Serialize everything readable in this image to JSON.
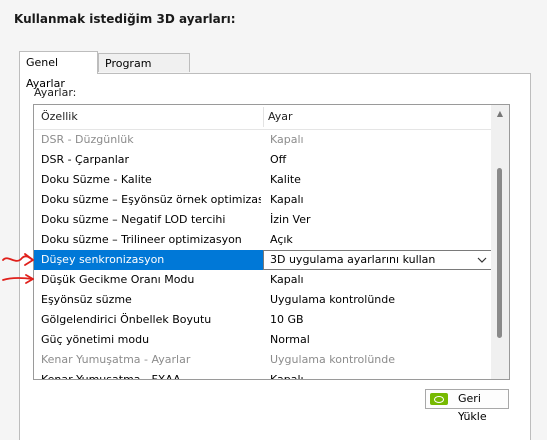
{
  "header": {
    "title": "Kullanmak istediğim 3D ayarları:"
  },
  "tabs": [
    {
      "label": "Genel Ayarlar",
      "active": true
    },
    {
      "label": "Program Ayarları",
      "active": false
    }
  ],
  "settings_label": "Ayarlar:",
  "table": {
    "columns": [
      "Özellik",
      "Ayar"
    ],
    "rows": [
      {
        "feature": "DSR - Düzgünlük",
        "value": "Kapalı",
        "disabled": true
      },
      {
        "feature": "DSR - Çarpanlar",
        "value": "Off"
      },
      {
        "feature": "Doku Süzme - Kalite",
        "value": "Kalite"
      },
      {
        "feature": "Doku süzme – Eşyönsüz örnek optimizasyonu",
        "value": "Kapalı"
      },
      {
        "feature": "Doku süzme – Negatif LOD tercihi",
        "value": "İzin Ver"
      },
      {
        "feature": "Doku süzme – Trilineer optimizasyon",
        "value": "Açık"
      },
      {
        "feature": "Düşey senkronizasyon",
        "value": "3D uygulama ayarlarını kullan",
        "selected": true
      },
      {
        "feature": "Düşük Gecikme Oranı Modu",
        "value": "Kapalı"
      },
      {
        "feature": "Eşyönsüz süzme",
        "value": "Uygulama kontrolünde"
      },
      {
        "feature": "Gölgelendirici Önbellek Boyutu",
        "value": "10 GB"
      },
      {
        "feature": "Güç yönetimi modu",
        "value": "Normal"
      },
      {
        "feature": "Kenar Yumuşatma - Ayarlar",
        "value": "Uygulama kontrolünde",
        "disabled": true
      },
      {
        "feature": "Kenar Yumuşatma - FXAA",
        "value": "Kapalı"
      }
    ]
  },
  "buttons": {
    "restore": "Geri Yükle"
  },
  "colors": {
    "selection": "#0078d7",
    "annotation": "#e0201b",
    "nvidia": "#76b900"
  },
  "icons": {
    "restore": "nvidia-icon",
    "dropdown": "chevron-down-icon"
  }
}
